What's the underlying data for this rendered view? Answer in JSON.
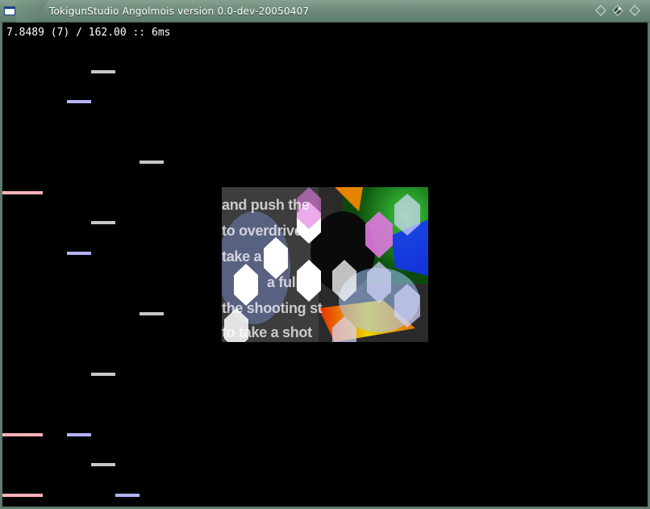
{
  "window": {
    "title": "TokigunStudio Angolmois version 0.0-dev-20050407",
    "icon": "window-icon",
    "buttons": [
      "minimize-icon",
      "maximize-icon",
      "close-icon"
    ],
    "frame_color": "#6f8d7c"
  },
  "stats": {
    "text": "7.8489 (7) / 162.00 :: 6ms",
    "measure": "7.8489",
    "measure_index": 7,
    "bpm": "162.00",
    "frame_time": "6ms"
  },
  "lane_colors": {
    "1": "#ffb3b8",
    "2": "#b4b4ff",
    "3": "#c8c8c8"
  },
  "bga": {
    "lines": [
      "and push the",
      "to overdrive",
      "take a",
      "a full",
      "the shooting st",
      "to take a shot"
    ]
  }
}
